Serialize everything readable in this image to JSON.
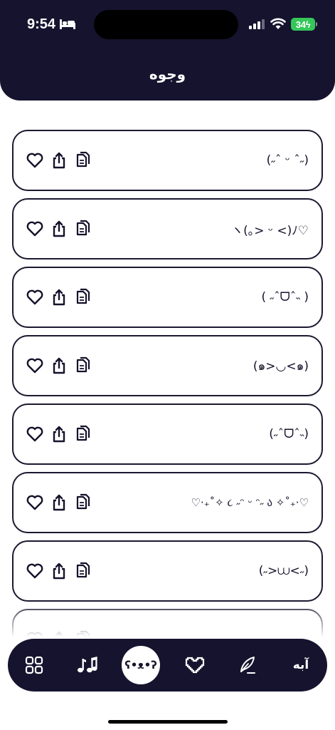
{
  "status_bar": {
    "time": "9:54",
    "battery": "34"
  },
  "header": {
    "title": "وجوه"
  },
  "cards": [
    {
      "face": "(˶ˆ ᵕ ˆ˶)"
    },
    {
      "face": "ヽ(｡> ᵕ <)ﾉ♡"
    },
    {
      "face": "( ˶ˆᗜˆ˵ )"
    },
    {
      "face": "(๑>◡<๑)"
    },
    {
      "face": "(˶ˆᗜˆ˵)"
    },
    {
      "face": "♡·₊˚✧ ૮ ˶ᵔ ᵕ ᵔ˶ ა ✧˚₊·♡"
    },
    {
      "face": "(˶>⩊<˶)"
    }
  ],
  "tabbar": {
    "active_tab_label": "ʕ•ᴥ•ʔ",
    "last_tab_label": "آبه"
  },
  "icons": {
    "card_actions": [
      "heart-icon",
      "share-icon",
      "copy-icon"
    ],
    "tabs": [
      "grid-icon",
      "music-notes-icon",
      "bear-face-tab",
      "pixel-heart-icon",
      "quill-icon",
      "text-tab"
    ]
  },
  "colors": {
    "header_background": "#16132e",
    "tabbar_background": "#16132e",
    "card_border": "#1b1930",
    "battery_green": "#34c759"
  }
}
